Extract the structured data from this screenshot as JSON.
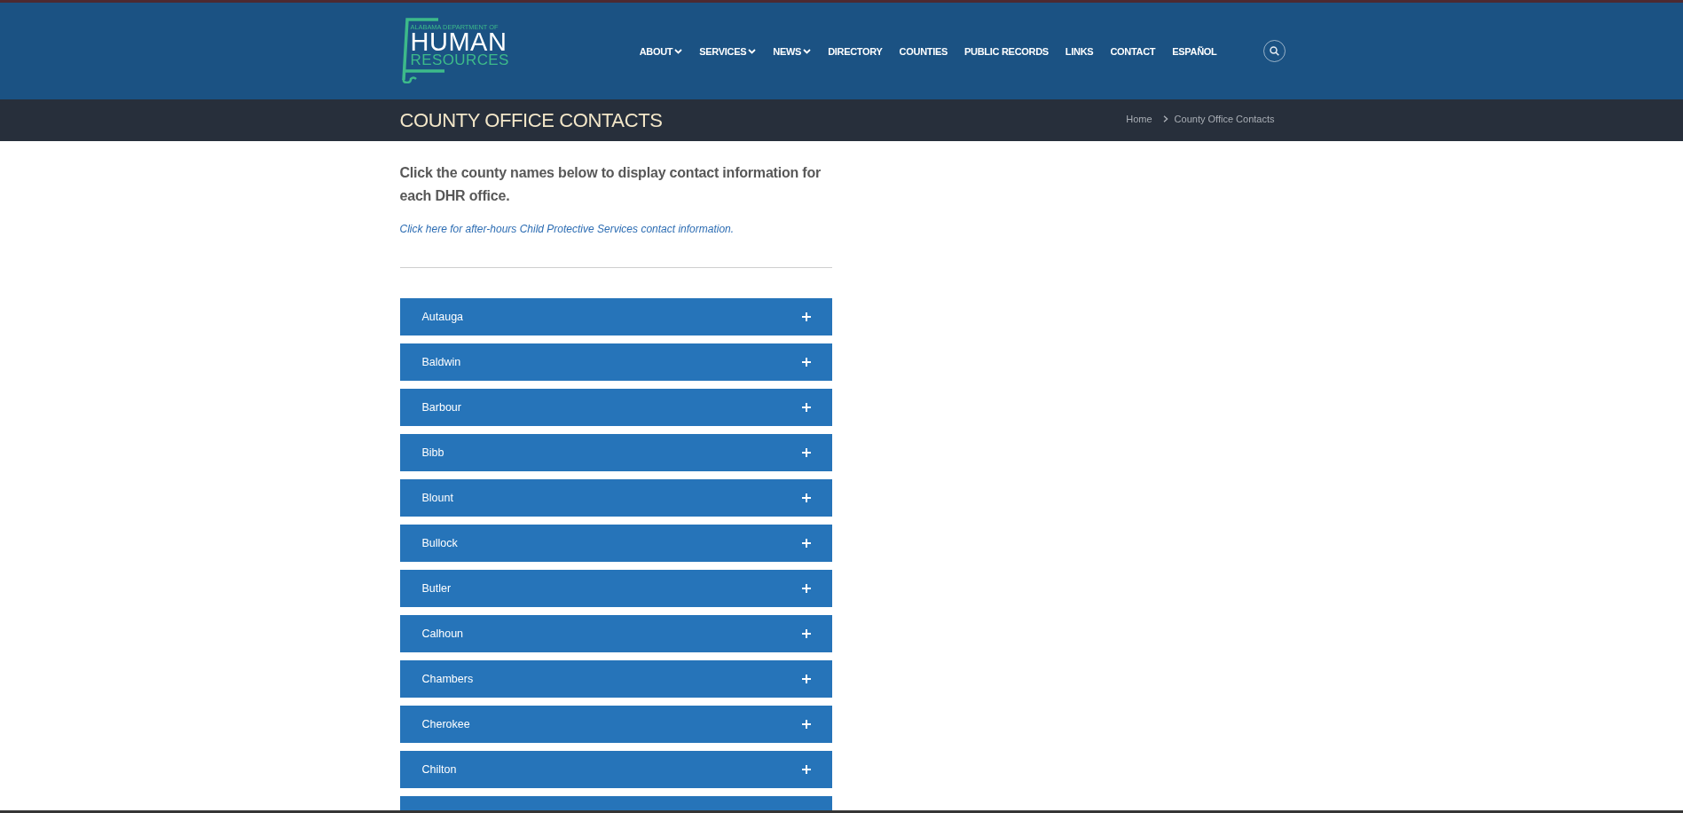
{
  "header": {
    "logo": {
      "line_1": "ALABAMA DEPARTMENT OF",
      "line_2": "HUMAN",
      "line_3": "RESOURCES"
    },
    "nav": [
      {
        "label": "ABOUT",
        "dropdown": true
      },
      {
        "label": "SERVICES",
        "dropdown": true
      },
      {
        "label": "NEWS",
        "dropdown": true
      },
      {
        "label": "DIRECTORY",
        "dropdown": false
      },
      {
        "label": "COUNTIES",
        "dropdown": false
      },
      {
        "label": "PUBLIC RECORDS",
        "dropdown": false
      },
      {
        "label": "LINKS",
        "dropdown": false
      },
      {
        "label": "CONTACT",
        "dropdown": false
      },
      {
        "label": "ESPAÑOL",
        "dropdown": false
      }
    ]
  },
  "title_bar": {
    "title": "COUNTY OFFICE CONTACTS",
    "breadcrumb": [
      {
        "label": "Home"
      },
      {
        "label": "County Office Contacts"
      }
    ]
  },
  "content": {
    "intro": "Click the county names below to display contact information for each DHR office.",
    "link": "Click here for after-hours Child Protective Services contact information.",
    "counties": [
      {
        "label": "Autauga",
        "expanded": false
      },
      {
        "label": "Baldwin",
        "expanded": false
      },
      {
        "label": "Barbour",
        "expanded": false
      },
      {
        "label": "Bibb",
        "expanded": false
      },
      {
        "label": "Blount",
        "expanded": false
      },
      {
        "label": "Bullock",
        "expanded": false
      },
      {
        "label": "Butler",
        "expanded": false
      },
      {
        "label": "Calhoun",
        "expanded": false
      },
      {
        "label": "Chambers",
        "expanded": false
      },
      {
        "label": "Cherokee",
        "expanded": false
      },
      {
        "label": "Chilton",
        "expanded": false
      }
    ],
    "next_row_partly_visible": true
  }
}
